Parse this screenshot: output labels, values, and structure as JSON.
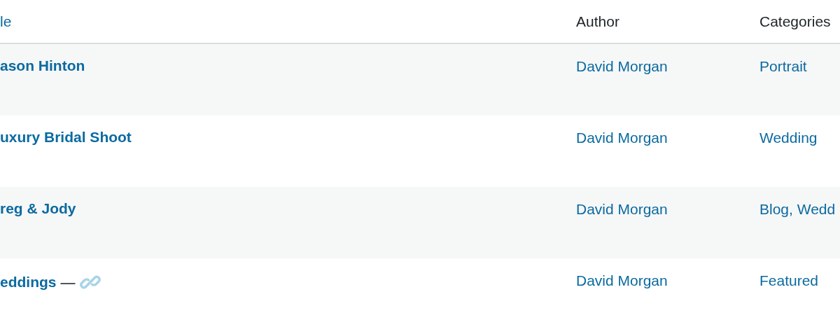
{
  "table": {
    "columns": [
      {
        "label": "le",
        "kind": "sortable"
      },
      {
        "label": "Author",
        "kind": "plain"
      },
      {
        "label": "Categories",
        "kind": "plain"
      }
    ],
    "rows": [
      {
        "kind": "standard",
        "title": "ason Hinton",
        "author": "David Morgan",
        "categories": "Portrait"
      },
      {
        "kind": "standard",
        "title": "uxury Bridal Shoot",
        "author": "David Morgan",
        "categories": "Wedding"
      },
      {
        "kind": "standard",
        "title": "reg & Jody",
        "author": "David Morgan",
        "categories": "Blog, Wedd"
      },
      {
        "kind": "link",
        "title": "eddings",
        "separator": "—",
        "author": "David Morgan",
        "categories": "Featured"
      }
    ]
  }
}
